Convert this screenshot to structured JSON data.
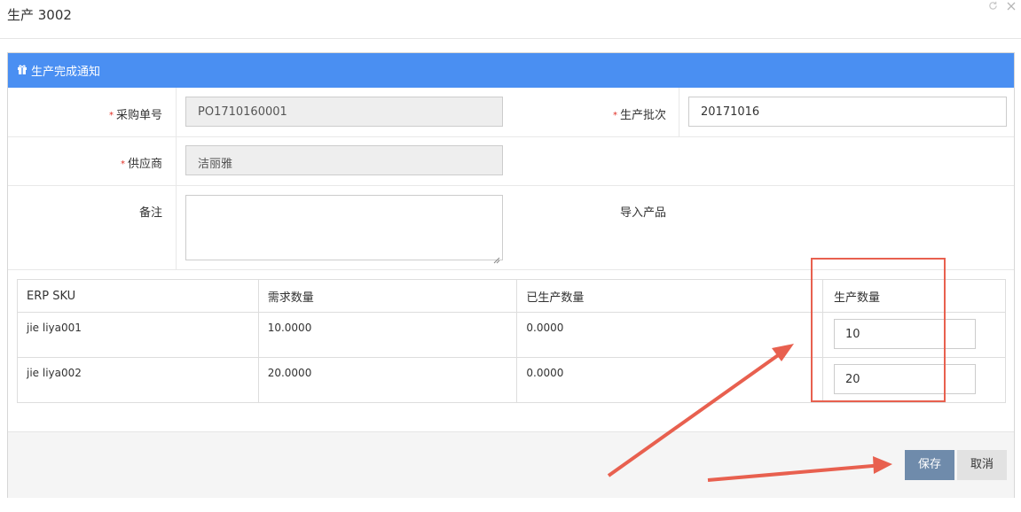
{
  "window": {
    "title": "生产 3002",
    "icons": [
      "refresh-icon",
      "close-icon"
    ]
  },
  "panel": {
    "title": "生产完成通知"
  },
  "form": {
    "purchase_no": {
      "label": "采购单号",
      "required": true,
      "value": "PO1710160001"
    },
    "batch": {
      "label": "生产批次",
      "required": true,
      "value": "20171016"
    },
    "supplier": {
      "label": "供应商",
      "required": true,
      "value": "洁丽雅"
    },
    "remark": {
      "label": "备注",
      "value": ""
    },
    "import_label": "导入产品"
  },
  "table": {
    "headers": [
      "ERP SKU",
      "需求数量",
      "已生产数量",
      "生产数量"
    ],
    "rows": [
      {
        "sku": "jie liya001",
        "required": "10.0000",
        "produced": "0.0000",
        "qty": "10"
      },
      {
        "sku": "jie liya002",
        "required": "20.0000",
        "produced": "0.0000",
        "qty": "20"
      }
    ]
  },
  "footer": {
    "save_label": "保存",
    "cancel_label": "取消"
  },
  "colors": {
    "header_blue": "#4a8ff2",
    "save_button": "#6f8bab",
    "annotation_red": "#e8604f",
    "required_star": "#e02e24"
  }
}
